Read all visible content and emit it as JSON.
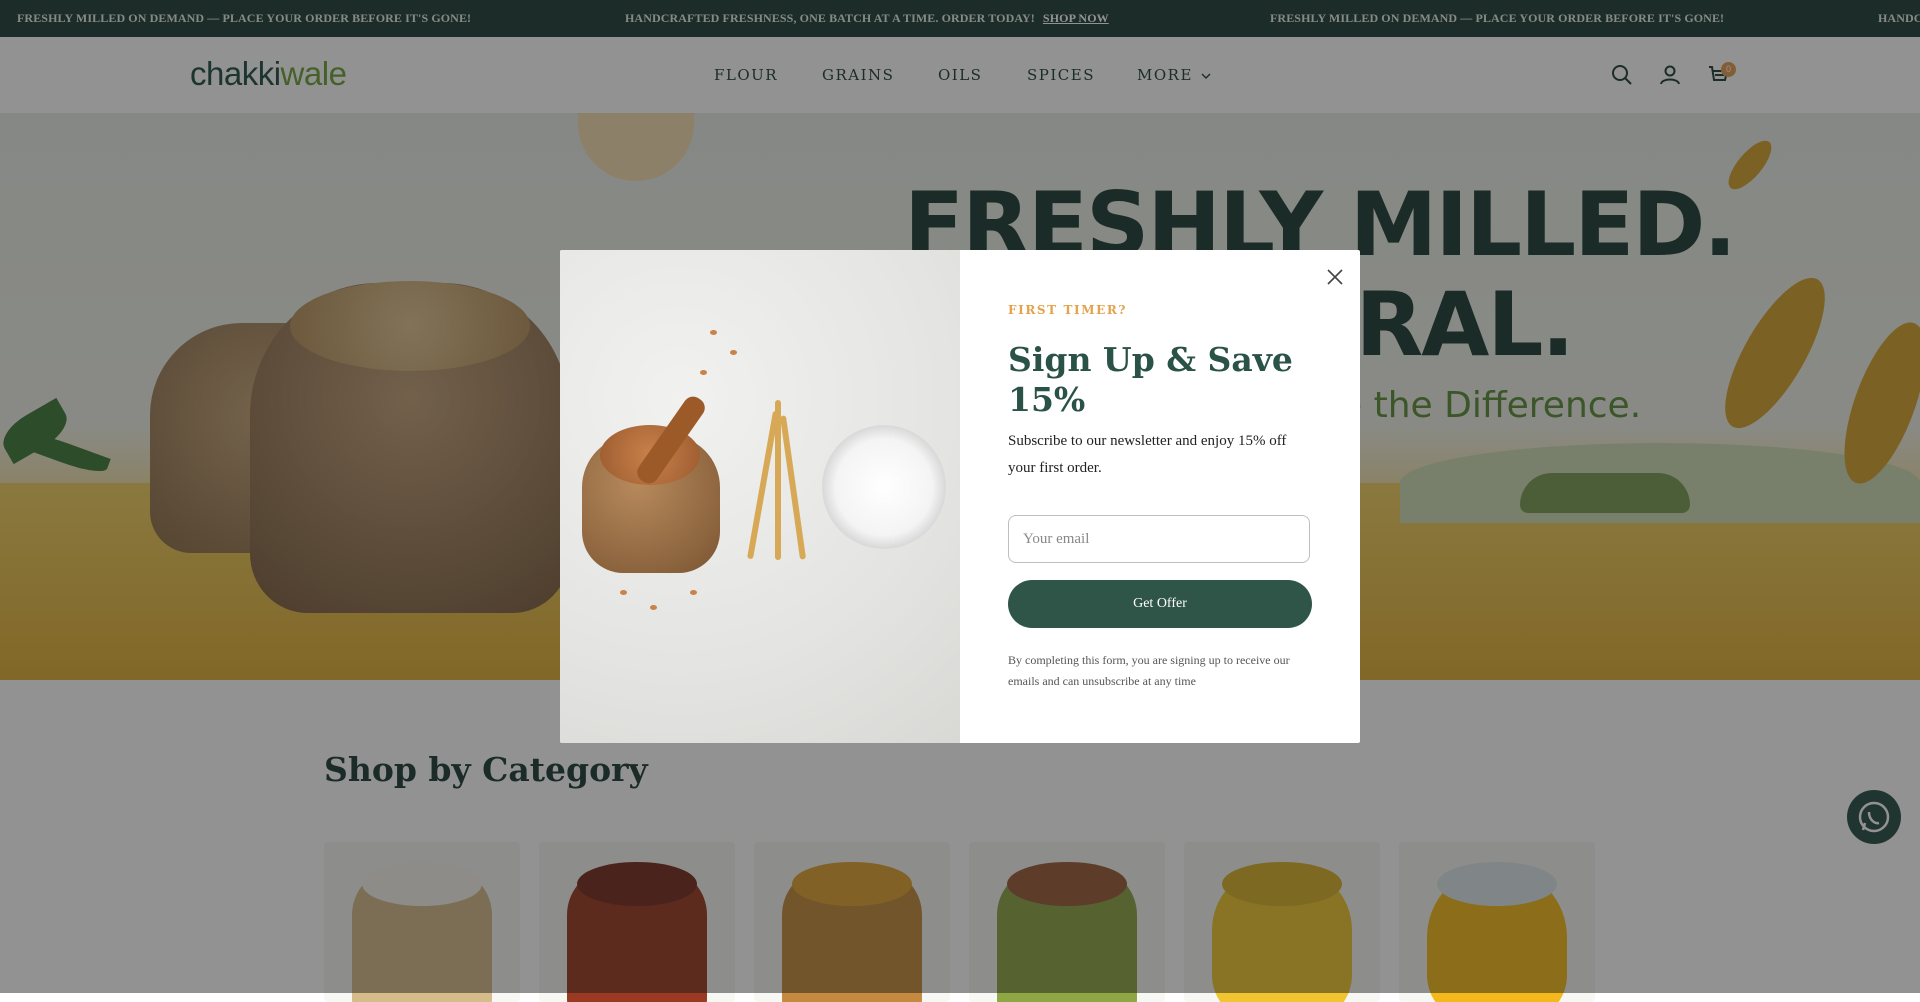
{
  "announcement": {
    "item1": "FRESHLY MILLED ON DEMAND — PLACE YOUR ORDER BEFORE IT'S GONE!",
    "item2": "HANDCRAFTED FRESHNESS, ONE BATCH AT A TIME. ORDER TODAY!",
    "link": "SHOP NOW",
    "item3": "FRESHLY MILLED ON DEMAND — PLACE YOUR ORDER BEFORE IT'S GONE!",
    "item4": "HANDC"
  },
  "header": {
    "logo_part1": "chakki",
    "logo_part2": "wale",
    "nav": [
      "FLOUR",
      "GRAINS",
      "OILS",
      "SPICES",
      "MORE"
    ],
    "cart_count": "0",
    "icons": [
      "search-icon",
      "account-icon",
      "cart-icon"
    ]
  },
  "hero": {
    "line1": "FRESHLY MILLED.",
    "line2": "TURAL.",
    "subline": "e the Difference."
  },
  "categories": {
    "title": "Shop by Category"
  },
  "modal": {
    "eyebrow": "FIRST TIMER?",
    "title": "Sign Up & Save 15%",
    "description": "Subscribe to our newsletter and enjoy 15% off your first order.",
    "email_placeholder": "Your email",
    "button": "Get Offer",
    "legal": "By completing this form, you are signing up to receive our emails and can unsubscribe at any time"
  },
  "colors": {
    "brand_dark": "#1f3d36",
    "brand_green": "#6ea23a",
    "accent": "#e3a24b",
    "button": "#2f5549"
  }
}
